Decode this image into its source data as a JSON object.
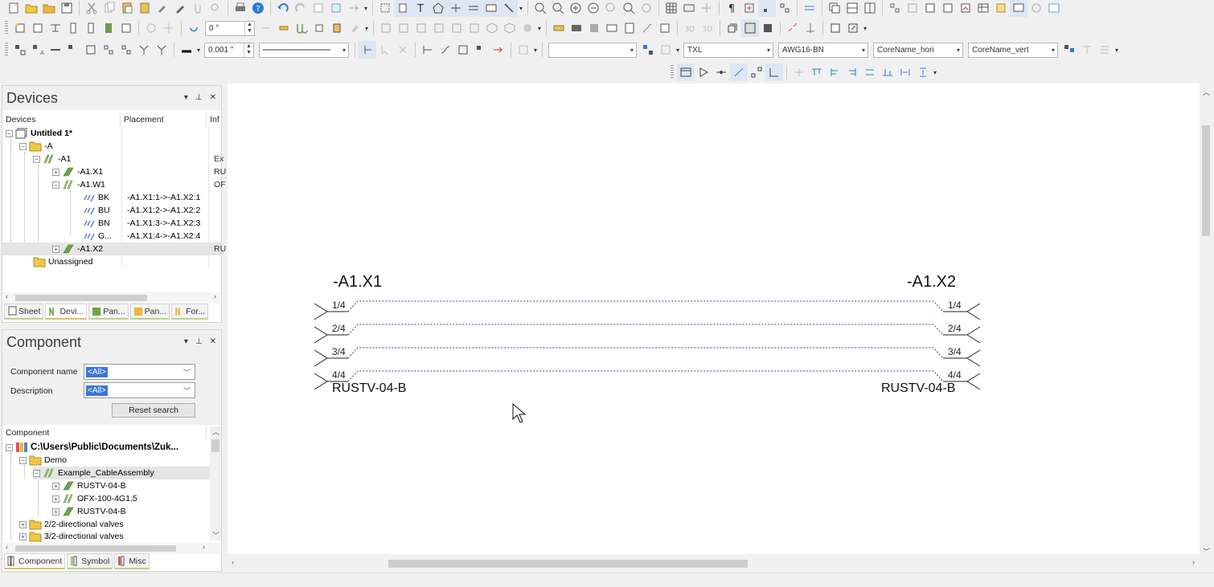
{
  "toolbar": {
    "row2": {
      "angle_value": "0 °"
    },
    "row3": {
      "line_width_value": "0.001 \"",
      "combo_blank": "",
      "style_combo": "TXL",
      "wire_combo": "AWG16-BN",
      "core_h_combo": "CoreName_hori",
      "core_v_combo": "CoreName_vert"
    }
  },
  "devices_panel": {
    "title": "Devices",
    "columns": [
      "Devices",
      "Placement",
      "Inf"
    ],
    "tree": [
      {
        "label": "Untitled 1*",
        "placement": "",
        "info": ""
      },
      {
        "label": "-A",
        "placement": "",
        "info": ""
      },
      {
        "label": "-A1",
        "placement": "",
        "info": "Ex"
      },
      {
        "label": "-A1.X1",
        "placement": "",
        "info": "RU"
      },
      {
        "label": "-A1.W1",
        "placement": "",
        "info": "OF"
      },
      {
        "label": "BK",
        "placement": "-A1.X1:1->-A1.X2:1",
        "info": ""
      },
      {
        "label": "BU",
        "placement": "-A1.X1:2->-A1.X2:2",
        "info": ""
      },
      {
        "label": "BN",
        "placement": "-A1.X1:3->-A1.X2:3",
        "info": ""
      },
      {
        "label": "G...",
        "placement": "-A1.X1:4->-A1.X2:4",
        "info": ""
      },
      {
        "label": "-A1.X2",
        "placement": "",
        "info": "RU"
      },
      {
        "label": "Unassigned",
        "placement": "",
        "info": ""
      }
    ],
    "tabs": [
      "Sheet",
      "Devi...",
      "Pan...",
      "Pan...",
      "For..."
    ]
  },
  "component_panel": {
    "title": "Component",
    "name_label": "Component name",
    "name_value": "<All>",
    "desc_label": "Description",
    "desc_value": "<All>",
    "reset_label": "Reset search",
    "columns": [
      "Component",
      "("
    ],
    "tree": [
      {
        "label": "C:\\Users\\Public\\Documents\\Zuk..."
      },
      {
        "label": "Demo"
      },
      {
        "label": "Example_CableAssembly"
      },
      {
        "label": "RUSTV-04-B"
      },
      {
        "label": "OFX-100-4G1.5"
      },
      {
        "label": "RUSTV-04-B"
      },
      {
        "label": "2/2-directional valves"
      },
      {
        "label": "3/2-directional valves"
      }
    ],
    "tabs": [
      "Component",
      "Symbol",
      "Misc"
    ]
  },
  "drawing": {
    "left_connector": "-A1.X1",
    "right_connector": "-A1.X2",
    "left_part": "RUSTV-04-B",
    "right_part": "RUSTV-04-B",
    "pins": [
      "1/4",
      "2/4",
      "3/4",
      "4/4"
    ],
    "wire_color": "#3a3aa0"
  }
}
